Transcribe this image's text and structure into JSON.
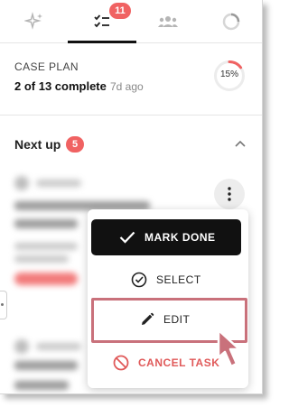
{
  "tabs": {
    "items": [
      {
        "name": "sparkle",
        "icon": "sparkle-icon"
      },
      {
        "name": "tasks",
        "icon": "checklist-icon",
        "badge": "11",
        "active": true
      },
      {
        "name": "people",
        "icon": "people-icon"
      },
      {
        "name": "progress",
        "icon": "progress-ring-icon"
      }
    ]
  },
  "case_plan": {
    "title": "CASE PLAN",
    "count": "2 of 13 complete",
    "ago": "7d ago",
    "percent_label": "15%",
    "percent": 15
  },
  "next_up": {
    "title": "Next up",
    "count": "5"
  },
  "menu": {
    "mark_done": "MARK DONE",
    "select": "SELECT",
    "edit": "EDIT",
    "cancel": "CANCEL TASK"
  },
  "colors": {
    "accent_red": "#f06262",
    "highlight": "#c9717b",
    "arrow": "#c9717b"
  }
}
